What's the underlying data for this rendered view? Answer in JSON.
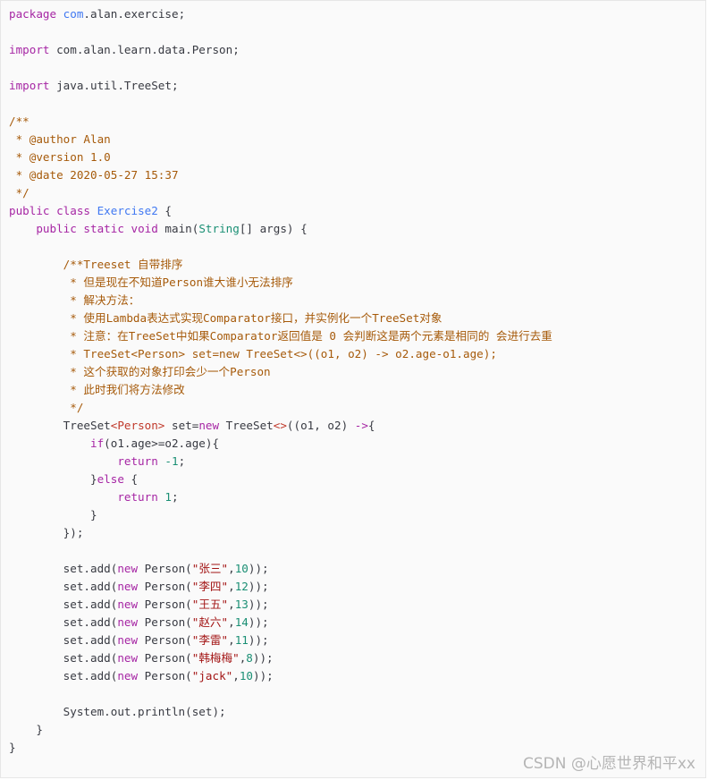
{
  "code": {
    "lines": [
      [
        {
          "t": "package ",
          "c": "kw"
        },
        {
          "t": "com",
          "c": "cls"
        },
        {
          "t": ".alan.exercise;",
          "c": ""
        }
      ],
      [],
      [
        {
          "t": "import ",
          "c": "kw"
        },
        {
          "t": "com.alan.learn.data.Person;",
          "c": ""
        }
      ],
      [],
      [
        {
          "t": "import ",
          "c": "kw"
        },
        {
          "t": "java.util.TreeSet;",
          "c": ""
        }
      ],
      [],
      [
        {
          "t": "/**",
          "c": "cm"
        }
      ],
      [
        {
          "t": " * @author Alan",
          "c": "cm"
        }
      ],
      [
        {
          "t": " * @version 1.0",
          "c": "cm"
        }
      ],
      [
        {
          "t": " * @date 2020-05-27 15:37",
          "c": "cm"
        }
      ],
      [
        {
          "t": " */",
          "c": "cm"
        }
      ],
      [
        {
          "t": "public ",
          "c": "kw"
        },
        {
          "t": "class ",
          "c": "kw"
        },
        {
          "t": "Exercise2",
          "c": "cls"
        },
        {
          "t": " {",
          "c": ""
        }
      ],
      [
        {
          "t": "    public ",
          "c": "kw"
        },
        {
          "t": "static ",
          "c": "kw"
        },
        {
          "t": "void ",
          "c": "kw"
        },
        {
          "t": "main(",
          "c": ""
        },
        {
          "t": "String",
          "c": "typ"
        },
        {
          "t": "[] args) {",
          "c": ""
        }
      ],
      [],
      [
        {
          "t": "        /**Treeset 自带排序",
          "c": "cm"
        }
      ],
      [
        {
          "t": "         * 但是现在不知道Person谁大谁小无法排序",
          "c": "cm"
        }
      ],
      [
        {
          "t": "         * 解决方法：",
          "c": "cm"
        }
      ],
      [
        {
          "t": "         * 使用Lambda表达式实现Comparator接口，并实例化一个TreeSet对象",
          "c": "cm"
        }
      ],
      [
        {
          "t": "         * 注意：在TreeSet中如果Comparator返回值是 0 会判断这是两个元素是相同的 会进行去重",
          "c": "cm"
        }
      ],
      [
        {
          "t": "         * TreeSet<Person> set=new TreeSet<>((o1, o2) -> o2.age-o1.age);",
          "c": "cm"
        }
      ],
      [
        {
          "t": "         * 这个获取的对象打印会少一个Person",
          "c": "cm"
        }
      ],
      [
        {
          "t": "         * 此时我们将方法修改",
          "c": "cm"
        }
      ],
      [
        {
          "t": "         */",
          "c": "cm"
        }
      ],
      [
        {
          "t": "        TreeSet",
          "c": ""
        },
        {
          "t": "<Person>",
          "c": "gen"
        },
        {
          "t": " set=",
          "c": ""
        },
        {
          "t": "new ",
          "c": "kw"
        },
        {
          "t": "TreeSet",
          "c": ""
        },
        {
          "t": "<>",
          "c": "gen"
        },
        {
          "t": "((o1, o2) ",
          "c": ""
        },
        {
          "t": "->",
          "c": "kw"
        },
        {
          "t": "{",
          "c": ""
        }
      ],
      [
        {
          "t": "            if",
          "c": "kw"
        },
        {
          "t": "(o1.age>=o2.age){",
          "c": ""
        }
      ],
      [
        {
          "t": "                return ",
          "c": "kw"
        },
        {
          "t": "-1",
          "c": "num"
        },
        {
          "t": ";",
          "c": ""
        }
      ],
      [
        {
          "t": "            }",
          "c": ""
        },
        {
          "t": "else ",
          "c": "kw"
        },
        {
          "t": "{",
          "c": ""
        }
      ],
      [
        {
          "t": "                return ",
          "c": "kw"
        },
        {
          "t": "1",
          "c": "num"
        },
        {
          "t": ";",
          "c": ""
        }
      ],
      [
        {
          "t": "            }",
          "c": ""
        }
      ],
      [
        {
          "t": "        });",
          "c": ""
        }
      ],
      [],
      [
        {
          "t": "        set.add(",
          "c": ""
        },
        {
          "t": "new ",
          "c": "kw"
        },
        {
          "t": "Person(",
          "c": ""
        },
        {
          "t": "\"张三\"",
          "c": "str"
        },
        {
          "t": ",",
          "c": ""
        },
        {
          "t": "10",
          "c": "num"
        },
        {
          "t": "));",
          "c": ""
        }
      ],
      [
        {
          "t": "        set.add(",
          "c": ""
        },
        {
          "t": "new ",
          "c": "kw"
        },
        {
          "t": "Person(",
          "c": ""
        },
        {
          "t": "\"李四\"",
          "c": "str"
        },
        {
          "t": ",",
          "c": ""
        },
        {
          "t": "12",
          "c": "num"
        },
        {
          "t": "));",
          "c": ""
        }
      ],
      [
        {
          "t": "        set.add(",
          "c": ""
        },
        {
          "t": "new ",
          "c": "kw"
        },
        {
          "t": "Person(",
          "c": ""
        },
        {
          "t": "\"王五\"",
          "c": "str"
        },
        {
          "t": ",",
          "c": ""
        },
        {
          "t": "13",
          "c": "num"
        },
        {
          "t": "));",
          "c": ""
        }
      ],
      [
        {
          "t": "        set.add(",
          "c": ""
        },
        {
          "t": "new ",
          "c": "kw"
        },
        {
          "t": "Person(",
          "c": ""
        },
        {
          "t": "\"赵六\"",
          "c": "str"
        },
        {
          "t": ",",
          "c": ""
        },
        {
          "t": "14",
          "c": "num"
        },
        {
          "t": "));",
          "c": ""
        }
      ],
      [
        {
          "t": "        set.add(",
          "c": ""
        },
        {
          "t": "new ",
          "c": "kw"
        },
        {
          "t": "Person(",
          "c": ""
        },
        {
          "t": "\"李雷\"",
          "c": "str"
        },
        {
          "t": ",",
          "c": ""
        },
        {
          "t": "11",
          "c": "num"
        },
        {
          "t": "));",
          "c": ""
        }
      ],
      [
        {
          "t": "        set.add(",
          "c": ""
        },
        {
          "t": "new ",
          "c": "kw"
        },
        {
          "t": "Person(",
          "c": ""
        },
        {
          "t": "\"韩梅梅\"",
          "c": "str"
        },
        {
          "t": ",",
          "c": ""
        },
        {
          "t": "8",
          "c": "num"
        },
        {
          "t": "));",
          "c": ""
        }
      ],
      [
        {
          "t": "        set.add(",
          "c": ""
        },
        {
          "t": "new ",
          "c": "kw"
        },
        {
          "t": "Person(",
          "c": ""
        },
        {
          "t": "\"jack\"",
          "c": "str"
        },
        {
          "t": ",",
          "c": ""
        },
        {
          "t": "10",
          "c": "num"
        },
        {
          "t": "));",
          "c": ""
        }
      ],
      [],
      [
        {
          "t": "        System.out.println(set);",
          "c": ""
        }
      ],
      [
        {
          "t": "    }",
          "c": ""
        }
      ],
      [
        {
          "t": "}",
          "c": ""
        }
      ]
    ]
  },
  "watermark": {
    "text": "CSDN @心愿世界和平xx"
  }
}
